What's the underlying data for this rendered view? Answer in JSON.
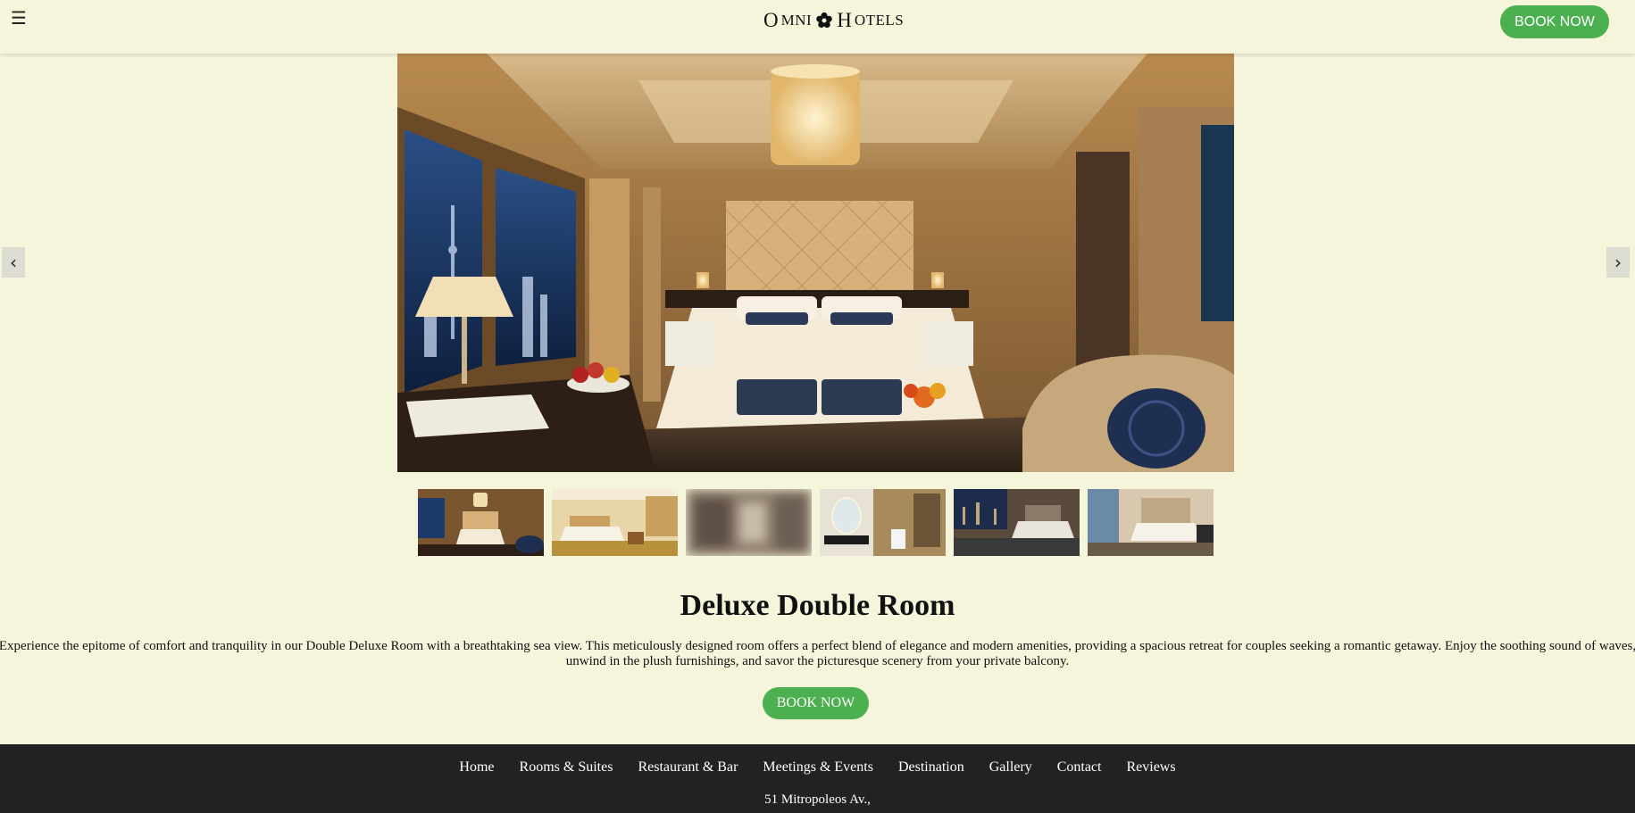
{
  "header": {
    "menu_icon": "menu-icon",
    "logo": {
      "part1_big": "O",
      "part1_small": "MNI",
      "part2_big": "H",
      "part2_small": "OTELS"
    },
    "book_label": "BOOK NOW",
    "accent_color": "#4caf50"
  },
  "carousel": {
    "prev_label": "‹",
    "next_label": "›",
    "thumbnails": [
      "room-1",
      "room-2",
      "room-3",
      "bathroom",
      "room-5",
      "room-6"
    ]
  },
  "room": {
    "title": "Deluxe Double Room",
    "description": "Experience the epitome of comfort and tranquility in our Double Deluxe Room with a breathtaking sea view. This meticulously designed room offers a perfect blend of elegance and modern amenities, providing a spacious retreat for couples seeking a romantic getaway. Enjoy the soothing sound of waves, unwind in the plush furnishings, and savor the picturesque scenery from your private balcony.",
    "book_label": "BOOK NOW"
  },
  "footer": {
    "nav": [
      "Home",
      "Rooms & Suites",
      "Restaurant & Bar",
      "Meetings & Events",
      "Destination",
      "Gallery",
      "Contact",
      "Reviews"
    ],
    "address": "51 Mitropoleos Av.,"
  },
  "colors": {
    "background": "#f5f5dc",
    "footer": "#222222",
    "button": "#4caf50"
  }
}
